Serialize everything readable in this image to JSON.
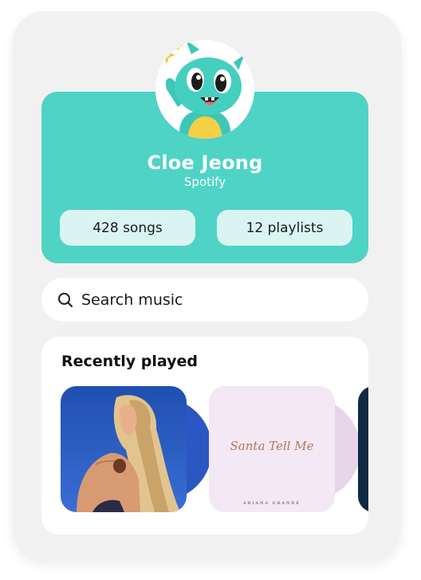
{
  "profile": {
    "name": "Cloe Jeong",
    "service": "Spotify",
    "avatar_icon": "dragon-mascot-icon",
    "stats": {
      "songs": "428 songs",
      "playlists": "12 playlists"
    }
  },
  "search": {
    "placeholder": "Search music",
    "icon": "search-icon"
  },
  "recent": {
    "title": "Recently played",
    "albums": [
      {
        "cover_text": "",
        "artist": ""
      },
      {
        "cover_text": "Santa Tell Me",
        "artist": "ARIANA GRANDE"
      },
      {
        "cover_text": "",
        "artist": ""
      }
    ]
  },
  "colors": {
    "accent": "#4fd3c5",
    "pill": "#daf4f2",
    "background": "#f1f1f1"
  }
}
